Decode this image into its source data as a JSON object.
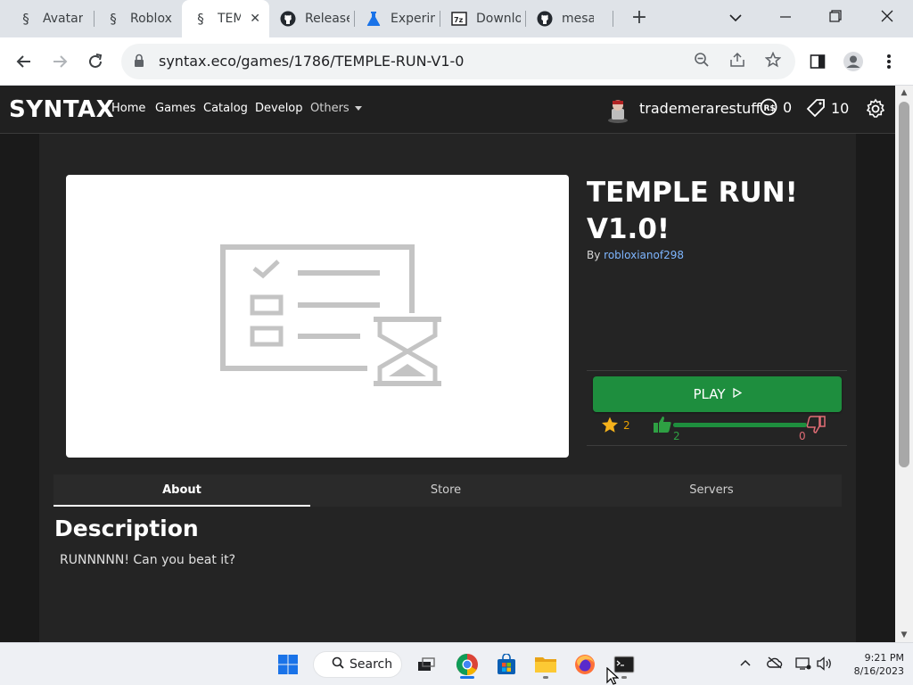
{
  "browser": {
    "tabs": [
      {
        "label": "Avatar",
        "icon": "syntax-logo-icon",
        "active": false
      },
      {
        "label": "Roblox",
        "icon": "syntax-logo-icon",
        "active": false
      },
      {
        "label": "TEMPLE",
        "icon": "syntax-logo-icon",
        "active": true
      },
      {
        "label": "Releases",
        "icon": "github-icon",
        "active": false
      },
      {
        "label": "Experiments",
        "icon": "flask-icon",
        "active": false
      },
      {
        "label": "Download",
        "icon": "7zip-icon",
        "active": false
      },
      {
        "label": "mesa-dist",
        "icon": "github-icon",
        "active": false
      }
    ],
    "url": "syntax.eco/games/1786/TEMPLE-RUN-V1-0"
  },
  "site": {
    "brand": "SYNTAX",
    "nav": {
      "home": "Home",
      "games": "Games",
      "catalog": "Catalog",
      "develop": "Develop",
      "others": "Others"
    },
    "user": {
      "name": "trademerarestuff",
      "robux": "0",
      "tickets": "10"
    }
  },
  "game": {
    "title": "TEMPLE RUN! V1.0!",
    "by_label": "By",
    "creator": "robloxianof298",
    "play_label": "PLAY",
    "favorites": "2",
    "likes": "2",
    "dislikes": "0",
    "like_ratio": 1.0,
    "tabs": {
      "about": "About",
      "store": "Store",
      "servers": "Servers"
    },
    "description_heading": "Description",
    "description": "RUNNNNN! Can you beat it?"
  },
  "taskbar": {
    "search_label": "Search",
    "time": "9:21 PM",
    "date": "8/16/2023"
  },
  "colors": {
    "accent_green": "#1e8e3e",
    "link_blue": "#7eb6ff",
    "favorite_gold": "#e8a000",
    "dislike_red": "#e06c75"
  }
}
